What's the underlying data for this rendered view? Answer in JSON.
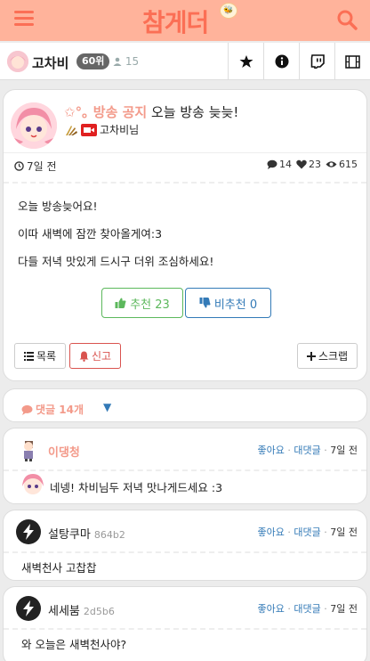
{
  "header": {
    "logo": "참게더",
    "logo_badge": "🐝"
  },
  "channel": {
    "name": "고차비",
    "rank": "60위",
    "viewers": "15"
  },
  "post": {
    "category": "✩°｡ 방송 공지",
    "title": "오늘 방송 늦늦!",
    "author": "고차비님",
    "date": "7일 전",
    "comments": "14",
    "likes": "23",
    "views": "615",
    "body": [
      "오늘 방송늦어요!",
      "이따 새벽에 잠깐 찾아올게여:3",
      "다들 저녁 맛있게 드시구 더위 조심하세요!"
    ],
    "upvote_label": "추천 23",
    "downvote_label": "비추천 0",
    "list_label": "목록",
    "report_label": "신고",
    "scrap_label": "스크랩"
  },
  "comments_header": {
    "label": "댓글 14개",
    "caret": "▼"
  },
  "comments": [
    {
      "name": "이댕청",
      "hash": "",
      "like": "좋아요",
      "reply": "대댓글",
      "date": "7일 전",
      "text": "네넹! 차비님두 저녁 맛나게드세요 :3"
    },
    {
      "name": "설탕쿠마",
      "hash": "864b2",
      "like": "좋아요",
      "reply": "대댓글",
      "date": "7일 전",
      "text": "새벽천사 고찹찹"
    },
    {
      "name": "세세붐",
      "hash": "2d5b6",
      "like": "좋아요",
      "reply": "대댓글",
      "date": "7일 전",
      "text": "와 오늘은 새벽천사야?"
    }
  ],
  "colors": {
    "header_bg": "#ffb39b",
    "brand": "#fb6f55",
    "category": "#f39a8a",
    "upvote": "#5cb85c",
    "downvote": "#337ab7",
    "report": "#d9534f"
  }
}
